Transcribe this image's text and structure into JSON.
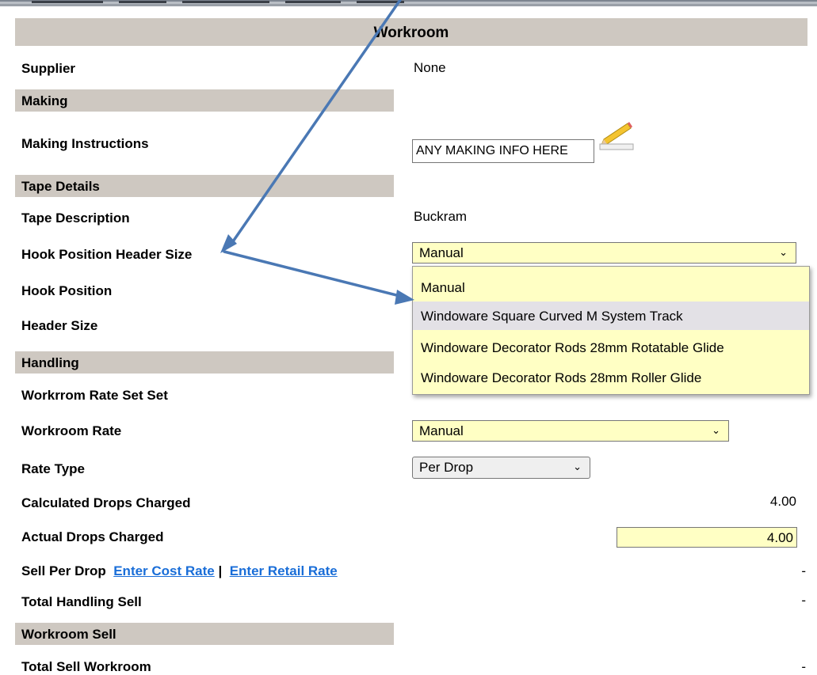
{
  "page": {
    "title": "Workroom",
    "supplier": {
      "label": "Supplier",
      "value": "None"
    },
    "sections": {
      "making": "Making",
      "tape_details": "Tape Details",
      "handling": "Handling",
      "workroom_sell": "Workroom Sell"
    },
    "making_instructions": {
      "label": "Making Instructions",
      "value": "ANY MAKING INFO HERE"
    },
    "tape_description": {
      "label": "Tape Description",
      "value": "Buckram"
    },
    "hook_position_header_size": {
      "label": "Hook Position Header Size",
      "selected": "Manual",
      "options": [
        "Manual",
        "Windoware Square Curved M System Track",
        "Windoware Decorator Rods 28mm Rotatable Glide",
        "Windoware Decorator Rods 28mm Roller Glide"
      ],
      "highlighted_index": 1
    },
    "hook_position": {
      "label": "Hook Position"
    },
    "header_size": {
      "label": "Header Size"
    },
    "workroom_rate_set": {
      "label": "Workrrom Rate Set Set"
    },
    "workroom_rate": {
      "label": "Workroom Rate",
      "selected": "Manual"
    },
    "rate_type": {
      "label": "Rate Type",
      "selected": "Per Drop"
    },
    "calculated_drops": {
      "label": "Calculated Drops Charged",
      "value": "4.00"
    },
    "actual_drops": {
      "label": "Actual Drops Charged",
      "value": "4.00"
    },
    "sell_per_drop": {
      "label": "Sell Per Drop",
      "cost_link": "Enter Cost Rate",
      "separator": "|",
      "retail_link": "Enter Retail Rate",
      "value": "-"
    },
    "total_handling_sell": {
      "label": "Total Handling Sell",
      "value": "-"
    },
    "total_sell_workroom": {
      "label": "Total Sell Workroom",
      "value": "-"
    }
  },
  "colors": {
    "header_bg": "#cec8c1",
    "input_yellow": "#ffffc4",
    "link_blue": "#1a6ed8",
    "arrow_blue": "#4a78b4",
    "highlight": "#e3e1e6"
  },
  "icons": {
    "chevron": "chevron-down-icon",
    "edit": "pencil-icon",
    "annotation": "arrow-annotation"
  }
}
